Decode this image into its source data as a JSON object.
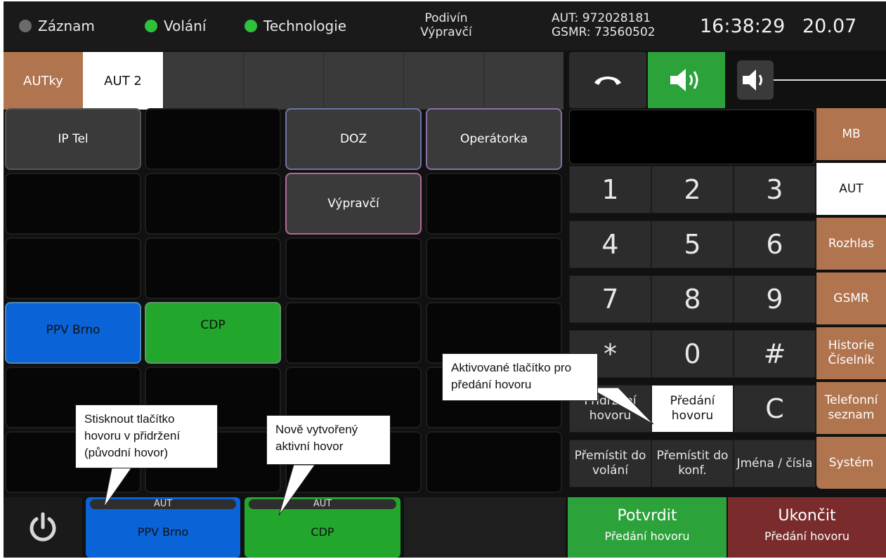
{
  "status_bar": {
    "indicators": [
      {
        "label": "Záznam",
        "color": "#6b6b6b"
      },
      {
        "label": "Volání",
        "color": "#2ec13b"
      },
      {
        "label": "Technologie",
        "color": "#2ec13b"
      }
    ],
    "station": "Podivín",
    "role": "Výpravčí",
    "aut_line": "AUT: 972028181",
    "gsmr_line": "GSMR: 73560502",
    "time": "16:38:29",
    "date": "20.07"
  },
  "tabs": [
    {
      "label": "AUTky",
      "color": "#b0744e"
    },
    {
      "label": "AUT 2",
      "color": "#ffffff"
    }
  ],
  "speed_dial": {
    "ip_tel": "IP Tel",
    "doz": "DOZ",
    "operatorka": "Operátorka",
    "vypravci": "Výpravčí",
    "ppv_brno": "PPV Brno",
    "cdp": "CDP"
  },
  "keypad": {
    "keys": [
      "1",
      "2",
      "3",
      "4",
      "5",
      "6",
      "7",
      "8",
      "9",
      "*",
      "0",
      "#"
    ],
    "hold": "Přidržení hovoru",
    "transfer": "Předání hovoru",
    "clear": "C",
    "move_call": "Přemístit do volání",
    "move_conf": "Přemístit do konf.",
    "names": "Jména / čísla"
  },
  "side_menu": [
    "MB",
    "AUT",
    "Rozhlas",
    "GSMR",
    "Historie Číselník",
    "Telefonní seznam",
    "Systém"
  ],
  "call_slots": [
    {
      "tag": "AUT",
      "label": "PPV Brno",
      "color": "#0b63d8"
    },
    {
      "tag": "AUT",
      "label": "CDP",
      "color": "#22a72c"
    }
  ],
  "actions": {
    "confirm_main": "Potvrdit",
    "confirm_sub": "Předání hovoru",
    "end_main": "Ukončit",
    "end_sub": "Předání hovoru"
  },
  "colors": {
    "confirm": "#2ba23a",
    "end": "#7a2c2c",
    "speaker_active": "#2ba23a",
    "menu_brown": "#b0744e"
  },
  "annotations": {
    "active_button": "Aktivované tlačítko pro předání hovoru",
    "press_hold": "Stisknout tlačítko hovoru v přidržení (původní hovor)",
    "new_call": "Nově vytvořený aktivní hovor"
  }
}
